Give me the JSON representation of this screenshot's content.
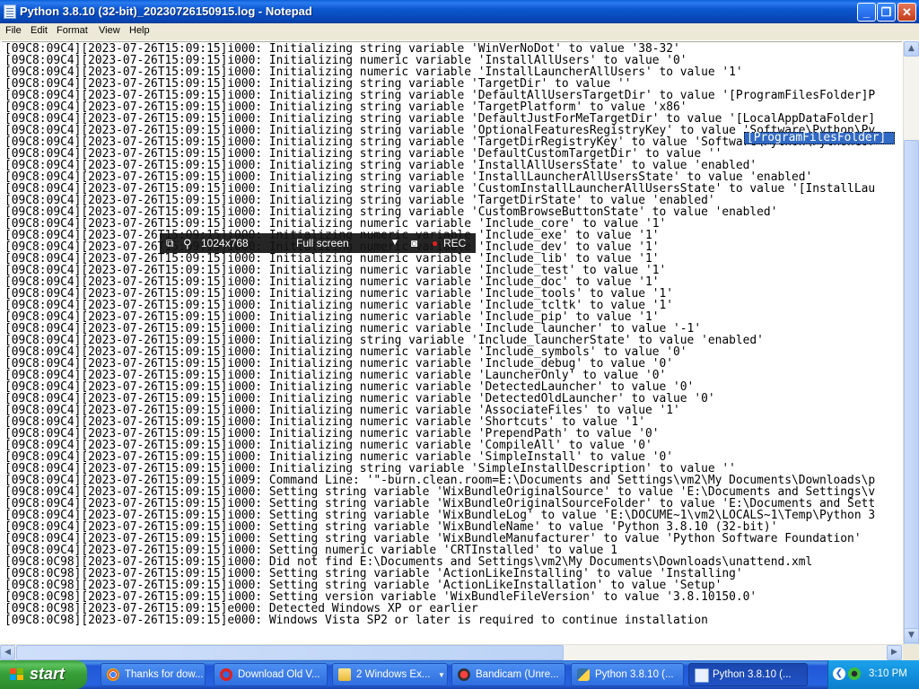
{
  "window": {
    "title": "Python 3.8.10 (32-bit)_20230726150915.log - Notepad",
    "buttons": {
      "minimize": "_",
      "maximize": "❐",
      "close": "✕"
    }
  },
  "menu": [
    "File",
    "Edit",
    "Format",
    "View",
    "Help"
  ],
  "log_lines": [
    "[09C8:09C4][2023-07-26T15:09:15]i000: Initializing string variable 'WinVerNoDot' to value '38-32'",
    "[09C8:09C4][2023-07-26T15:09:15]i000: Initializing numeric variable 'InstallAllUsers' to value '0'",
    "[09C8:09C4][2023-07-26T15:09:15]i000: Initializing numeric variable 'InstallLauncherAllUsers' to value '1'",
    "[09C8:09C4][2023-07-26T15:09:15]i000: Initializing string variable 'TargetDir' to value ''",
    "[09C8:09C4][2023-07-26T15:09:15]i000: Initializing string variable 'DefaultAllUsersTargetDir' to value '[ProgramFilesFolder]P",
    "[09C8:09C4][2023-07-26T15:09:15]i000: Initializing string variable 'TargetPlatform' to value 'x86'",
    "[09C8:09C4][2023-07-26T15:09:15]i000: Initializing string variable 'DefaultJustForMeTargetDir' to value '[LocalAppDataFolder]",
    "[09C8:09C4][2023-07-26T15:09:15]i000: Initializing string variable 'OptionalFeaturesRegistryKey' to value 'Software\\Python\\Py",
    "[09C8:09C4][2023-07-26T15:09:15]i000: Initializing string variable 'TargetDirRegistryKey' to value 'Software\\Python\\PythonCor",
    "[09C8:09C4][2023-07-26T15:09:15]i000: Initializing string variable 'DefaultCustomTargetDir' to value ''",
    "[09C8:09C4][2023-07-26T15:09:15]i000: Initializing string variable 'InstallAllUsersState' to value 'enabled'",
    "[09C8:09C4][2023-07-26T15:09:15]i000: Initializing string variable 'InstallLauncherAllUsersState' to value 'enabled'",
    "[09C8:09C4][2023-07-26T15:09:15]i000: Initializing string variable 'CustomInstallLauncherAllUsersState' to value '[InstallLau",
    "[09C8:09C4][2023-07-26T15:09:15]i000: Initializing string variable 'TargetDirState' to value 'enabled'",
    "[09C8:09C4][2023-07-26T15:09:15]i000: Initializing string variable 'CustomBrowseButtonState' to value 'enabled'",
    "[09C8:09C4][2023-07-26T15:09:15]i000: Initializing numeric variable 'Include_core' to value '1'",
    "[09C8:09C4][2023-07-26T15:09:15]i000: Initializing numeric variable 'Include_exe' to value '1'",
    "[09C8:09C4][2023-07-26T15:09:15]i000: Initializing numeric variable 'Include_dev' to value '1'",
    "[09C8:09C4][2023-07-26T15:09:15]i000: Initializing numeric variable 'Include_lib' to value '1'",
    "[09C8:09C4][2023-07-26T15:09:15]i000: Initializing numeric variable 'Include_test' to value '1'",
    "[09C8:09C4][2023-07-26T15:09:15]i000: Initializing numeric variable 'Include_doc' to value '1'",
    "[09C8:09C4][2023-07-26T15:09:15]i000: Initializing numeric variable 'Include_tools' to value '1'",
    "[09C8:09C4][2023-07-26T15:09:15]i000: Initializing numeric variable 'Include_tcltk' to value '1'",
    "[09C8:09C4][2023-07-26T15:09:15]i000: Initializing numeric variable 'Include_pip' to value '1'",
    "[09C8:09C4][2023-07-26T15:09:15]i000: Initializing numeric variable 'Include_launcher' to value '-1'",
    "[09C8:09C4][2023-07-26T15:09:15]i000: Initializing string variable 'Include_launcherState' to value 'enabled'",
    "[09C8:09C4][2023-07-26T15:09:15]i000: Initializing numeric variable 'Include_symbols' to value '0'",
    "[09C8:09C4][2023-07-26T15:09:15]i000: Initializing numeric variable 'Include_debug' to value '0'",
    "[09C8:09C4][2023-07-26T15:09:15]i000: Initializing numeric variable 'LauncherOnly' to value '0'",
    "[09C8:09C4][2023-07-26T15:09:15]i000: Initializing numeric variable 'DetectedLauncher' to value '0'",
    "[09C8:09C4][2023-07-26T15:09:15]i000: Initializing numeric variable 'DetectedOldLauncher' to value '0'",
    "[09C8:09C4][2023-07-26T15:09:15]i000: Initializing numeric variable 'AssociateFiles' to value '1'",
    "[09C8:09C4][2023-07-26T15:09:15]i000: Initializing numeric variable 'Shortcuts' to value '1'",
    "[09C8:09C4][2023-07-26T15:09:15]i000: Initializing numeric variable 'PrependPath' to value '0'",
    "[09C8:09C4][2023-07-26T15:09:15]i000: Initializing numeric variable 'CompileAll' to value '0'",
    "[09C8:09C4][2023-07-26T15:09:15]i000: Initializing numeric variable 'SimpleInstall' to value '0'",
    "[09C8:09C4][2023-07-26T15:09:15]i000: Initializing string variable 'SimpleInstallDescription' to value ''",
    "[09C8:09C4][2023-07-26T15:09:15]i009: Command Line: '\"-burn.clean.room=E:\\Documents and Settings\\vm2\\My Documents\\Downloads\\p",
    "[09C8:09C4][2023-07-26T15:09:15]i000: Setting string variable 'WixBundleOriginalSource' to value 'E:\\Documents and Settings\\v",
    "[09C8:09C4][2023-07-26T15:09:15]i000: Setting string variable 'WixBundleOriginalSourceFolder' to value 'E:\\Documents and Sett",
    "[09C8:09C4][2023-07-26T15:09:15]i000: Setting string variable 'WixBundleLog' to value 'E:\\DOCUME~1\\vm2\\LOCALS~1\\Temp\\Python 3",
    "[09C8:09C4][2023-07-26T15:09:15]i000: Setting string variable 'WixBundleName' to value 'Python 3.8.10 (32-bit)'",
    "[09C8:09C4][2023-07-26T15:09:15]i000: Setting string variable 'WixBundleManufacturer' to value 'Python Software Foundation'",
    "[09C8:09C4][2023-07-26T15:09:15]i000: Setting numeric variable 'CRTInstalled' to value 1",
    "[09C8:0C98][2023-07-26T15:09:15]i000: Did not find E:\\Documents and Settings\\vm2\\My Documents\\Downloads\\unattend.xml",
    "[09C8:0C98][2023-07-26T15:09:15]i000: Setting string variable 'ActionLikeInstalling' to value 'Installing'",
    "[09C8:0C98][2023-07-26T15:09:15]i000: Setting string variable 'ActionLikeInstallation' to value 'Setup'",
    "[09C8:0C98][2023-07-26T15:09:15]i000: Setting version variable 'WixBundleFileVersion' to value '3.8.10150.0'",
    "[09C8:0C98][2023-07-26T15:09:15]e000: Detected Windows XP or earlier",
    "[09C8:0C98][2023-07-26T15:09:15]e000: Windows Vista SP2 or later is required to continue installation"
  ],
  "selection_text": "[ProgramFilesFolder]",
  "bandicam": {
    "resolution": "1024x768",
    "mode": "Full screen",
    "rec": "REC"
  },
  "taskbar": {
    "start": "start",
    "tasks": [
      {
        "label": "Thanks for dow...",
        "icon": "chrome-icon"
      },
      {
        "label": "Download Old V...",
        "icon": "opera-icon"
      },
      {
        "label": "2 Windows Ex...",
        "icon": "folder-icon"
      },
      {
        "label": "Bandicam (Unre...",
        "icon": "bandicam-icon"
      },
      {
        "label": "Python 3.8.10 (...",
        "icon": "python-installer-icon"
      },
      {
        "label": "Python 3.8.10 (...",
        "icon": "notepad-icon"
      }
    ],
    "clock": "3:10 PM"
  },
  "colors": {
    "titlebar": "#0a57d0",
    "selection": "#316ac5",
    "taskbar": "#2663e0",
    "start": "#38a038",
    "rec_dot": "#e02020"
  }
}
